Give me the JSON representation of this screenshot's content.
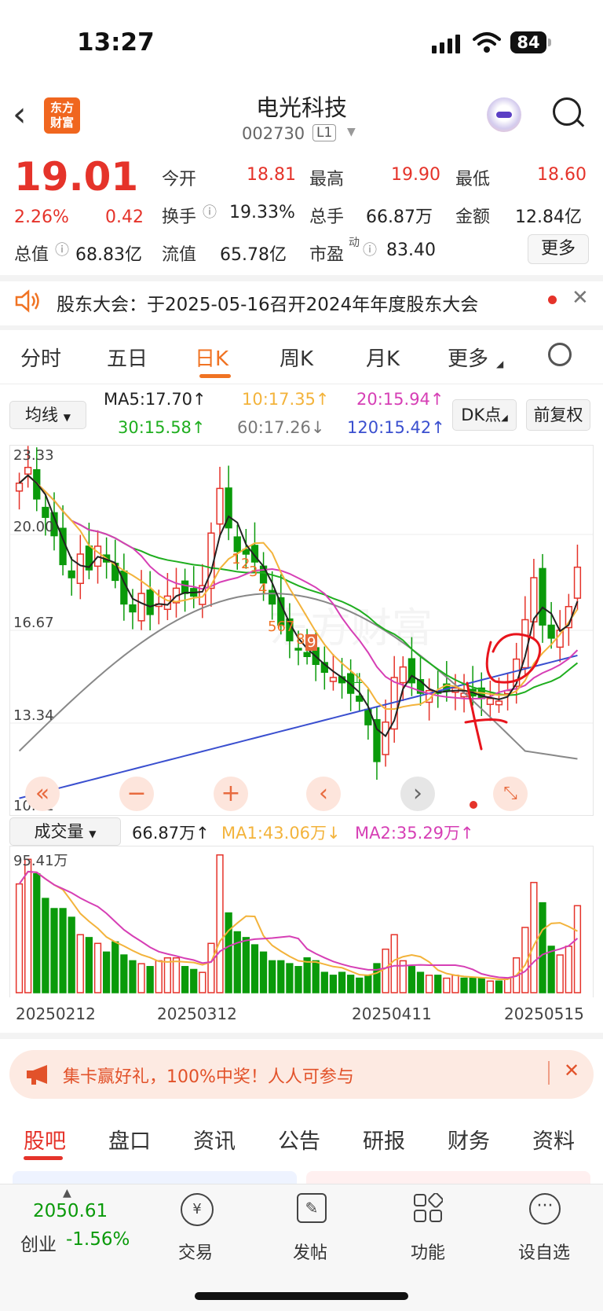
{
  "status": {
    "time": "13:27",
    "battery": "84"
  },
  "header": {
    "logo_line1": "东方",
    "logo_line2": "财富",
    "stock_name": "电光科技",
    "stock_code": "002730",
    "level": "L1"
  },
  "quote": {
    "price": "19.01",
    "change_pct": "2.26%",
    "change": "0.42",
    "open_label": "今开",
    "open": "18.81",
    "high_label": "最高",
    "high": "19.90",
    "low_label": "最低",
    "low": "18.60",
    "turnover_label": "换手",
    "turnover": "19.33%",
    "volume_label": "总手",
    "volume": "66.87万",
    "amount_label": "金额",
    "amount": "12.84亿",
    "mktcap_label": "总值",
    "mktcap": "68.83亿",
    "float_label": "流值",
    "float": "65.78亿",
    "pe_label": "市盈",
    "pe_sup": "动",
    "pe": "83.40",
    "more_label": "更多"
  },
  "notice": {
    "text": "股东大会：于2025-05-16召开2024年年度股东大会"
  },
  "tabs": [
    "分时",
    "五日",
    "日K",
    "周K",
    "月K",
    "更多"
  ],
  "indicators": {
    "ma_select": "均线",
    "ma5": "MA5:17.70↑",
    "ma10": "10:17.35↑",
    "ma20": "20:15.94↑",
    "ma30": "30:15.58↑",
    "ma60": "60:17.26↓",
    "ma120": "120:15.42↑",
    "dk_label": "DK点",
    "adjust_label": "前复权"
  },
  "colors": {
    "up": "#e5332a",
    "down": "#0a9a0a",
    "ma5": "#222222",
    "ma10": "#f3b33b",
    "ma20": "#d63fb5",
    "ma30": "#1fae1f",
    "ma60": "#888888",
    "ma120": "#3a4fcf",
    "accent": "#f07323"
  },
  "price_axis": {
    "labels": [
      "23.33",
      "20.00",
      "16.67",
      "13.34",
      "10.01"
    ]
  },
  "markers": [
    "1",
    "2",
    "3",
    "4",
    "567",
    "8",
    "9"
  ],
  "volume": {
    "select": "成交量",
    "value": "66.87万↑",
    "ma1": "MA1:43.06万↓",
    "ma2": "MA2:35.29万↑",
    "max_label": "95.41万"
  },
  "dates": [
    "20250212",
    "20250312",
    "20250411",
    "20250515"
  ],
  "ad": {
    "text": "集卡赢好礼，100%中奖！人人可参与"
  },
  "bottom_tabs": [
    "股吧",
    "盘口",
    "资讯",
    "公告",
    "研报",
    "财务",
    "资料"
  ],
  "dock": {
    "index_value": "2050.61",
    "index_name": "创业",
    "index_change": "-1.56%",
    "trade": "交易",
    "post": "发帖",
    "func": "功能",
    "watch": "设自选"
  }
}
